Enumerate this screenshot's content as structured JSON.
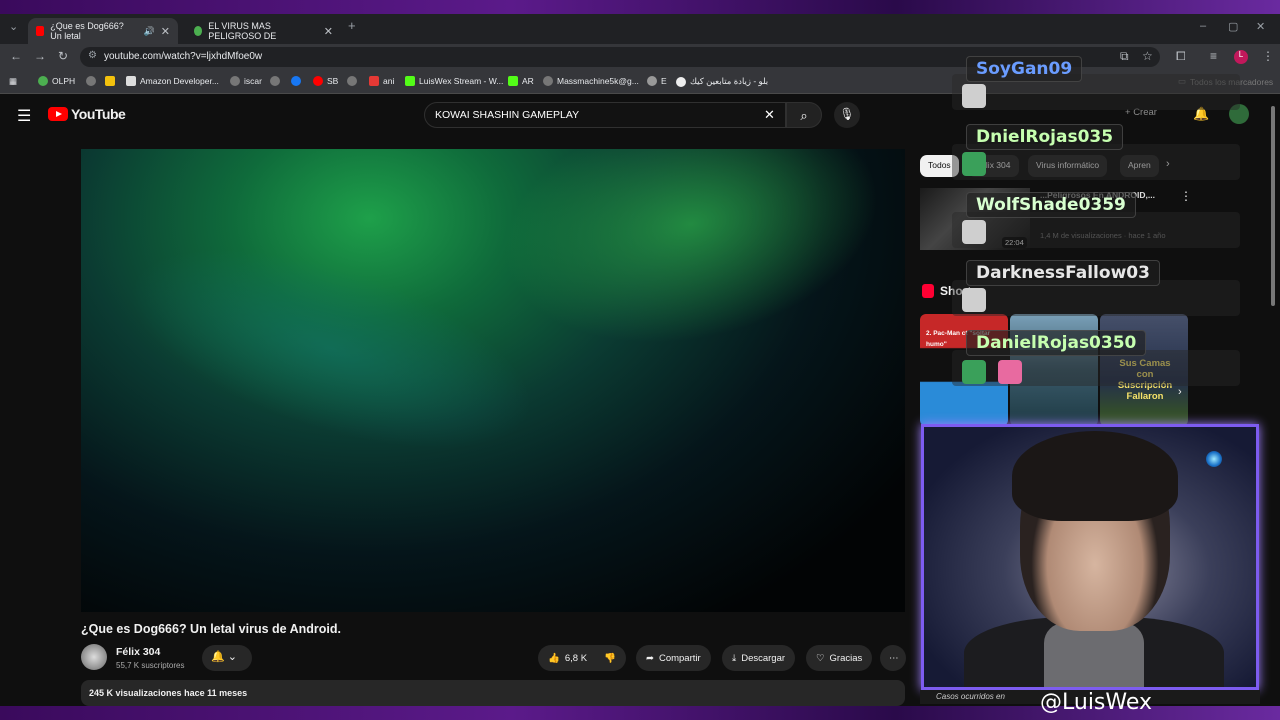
{
  "browser": {
    "tabs": [
      {
        "label": "¿Que es Dog666? Un letal"
      },
      {
        "label": "EL VIRUS MAS PELIGROSO DE"
      }
    ],
    "url": "youtube.com/watch?v=ljxhdMfoe0w",
    "bookmarks": [
      "OLPH",
      "Amazon Developer...",
      "iscar",
      "SB",
      "ani",
      "LuisWex Stream - W...",
      "AR",
      "Massmachine5k@g...",
      "E",
      "بلو - زيادة متابعين كيك"
    ],
    "all_bookmarks": "Todos los marcadores"
  },
  "youtube": {
    "logo": "YouTube",
    "search_query": "KOWAI SHASHIN GAMEPLAY",
    "create_label": "Crear"
  },
  "video": {
    "title": "¿Que es Dog666? Un letal virus de Android.",
    "channel": "Félix 304",
    "subscribers": "55,7 K suscriptores",
    "likes": "6,8 K",
    "share_label": "Compartir",
    "download_label": "Descargar",
    "thanks_label": "Gracias",
    "views": "245 K visualizaciones",
    "published": "hace 11 meses"
  },
  "sidebar": {
    "chips": [
      "Todos",
      "Félix 304",
      "Virus informático",
      "Apren"
    ],
    "recommended": {
      "title": "...Peligrosos En ANDROID,...",
      "duration": "22:04",
      "meta": "1,4 M de visualizaciones · hace 1 año"
    },
    "shorts_label": "Shorts",
    "short_captions": [
      "2. Pac-Man ct \"soltar humo\"",
      "Sus Camas con Suscripción Fallaron"
    ],
    "bottom_tease": "Casos ocurridos en"
  },
  "stream_overlay": {
    "chat_users": [
      "SoyGan09",
      "DnielRojas035",
      "WolfShade0359",
      "DarknessFallow03",
      "DanielRojas0350"
    ],
    "handle": "@LuisWex"
  },
  "colors": {
    "yt_red": "#ff0000",
    "webcam_border": "#7d5cf0",
    "frame": "#5b1a8a"
  }
}
